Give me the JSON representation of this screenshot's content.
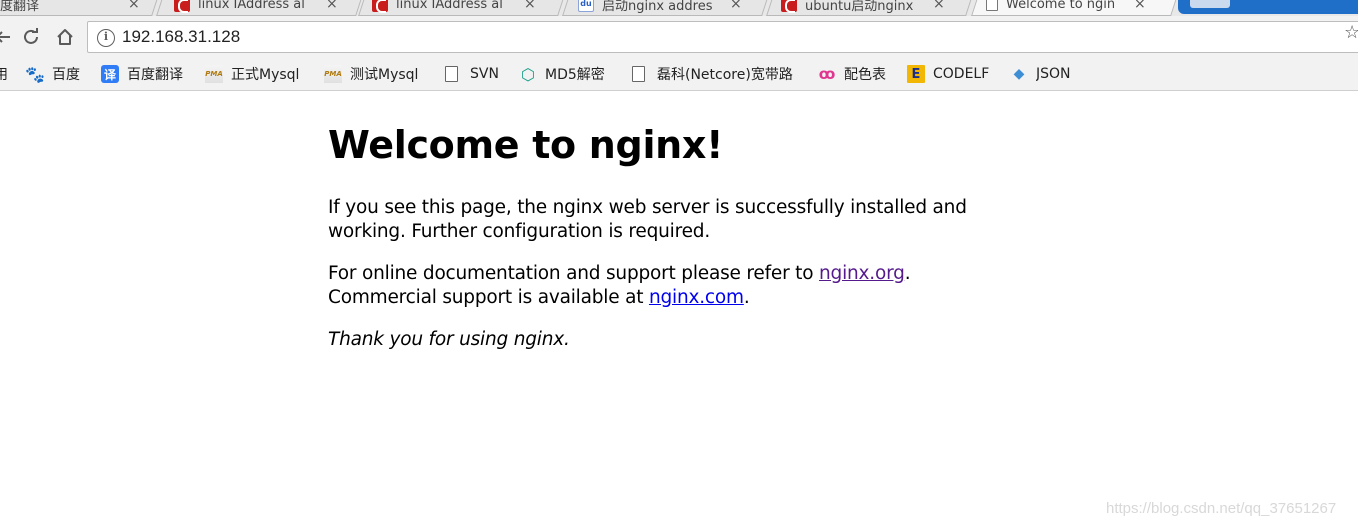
{
  "tabs": [
    {
      "title": "度翻译",
      "favicon": "document-icon",
      "active": false
    },
    {
      "title": "linux IAddress al",
      "favicon": "csdn-icon",
      "active": false
    },
    {
      "title": "linux IAddress al",
      "favicon": "csdn-icon",
      "active": false
    },
    {
      "title": "启动nginx addres",
      "favicon": "baidu-icon",
      "active": false
    },
    {
      "title": "ubuntu启动nginx",
      "favicon": "csdn-icon",
      "active": false
    },
    {
      "title": "Welcome to ngin",
      "favicon": "document-icon",
      "active": true
    }
  ],
  "tab_close_glyph": "×",
  "toolbar": {
    "back_glyph": "←",
    "reload_glyph": "↻",
    "home_glyph": "⌂",
    "info_glyph": "i",
    "url": "192.168.31.128",
    "star_glyph": "☆"
  },
  "bookmarks": [
    {
      "label": "用",
      "icon": "none"
    },
    {
      "label": "百度",
      "icon": "baidu-paw-icon"
    },
    {
      "label": "百度翻译",
      "icon": "baidu-translate-icon"
    },
    {
      "label": "正式Mysql",
      "icon": "phpmyadmin-icon"
    },
    {
      "label": "测试Mysql",
      "icon": "phpmyadmin-icon"
    },
    {
      "label": "SVN",
      "icon": "file-icon"
    },
    {
      "label": "MD5解密",
      "icon": "md5-icon"
    },
    {
      "label": "磊科(Netcore)宽带路",
      "icon": "file-icon"
    },
    {
      "label": "配色表",
      "icon": "color-icon"
    },
    {
      "label": "CODELF",
      "icon": "codelf-icon"
    },
    {
      "label": "JSON",
      "icon": "json-icon"
    }
  ],
  "bookmark_glyphs": {
    "paw": "🐾",
    "yi": "译",
    "pma": "PMA",
    "md5": "⬡",
    "color": "ꝏ",
    "codelf": "E",
    "json": "◆"
  },
  "page": {
    "heading": "Welcome to nginx!",
    "para1": "If you see this page, the nginx web server is successfully installed and working. Further configuration is required.",
    "para2_prefix": "For online documentation and support please refer to ",
    "link1": "nginx.org",
    "para2_mid": ".",
    "para2_line2_prefix": "Commercial support is available at ",
    "link2": "nginx.com",
    "para2_suffix": ".",
    "thanks": "Thank you for using nginx."
  },
  "watermark": "https://blog.csdn.net/qq_37651267",
  "colors": {
    "visited_link": "#551a8b",
    "link": "#0000ee",
    "active_tab_accent": "#1f6fc9"
  }
}
